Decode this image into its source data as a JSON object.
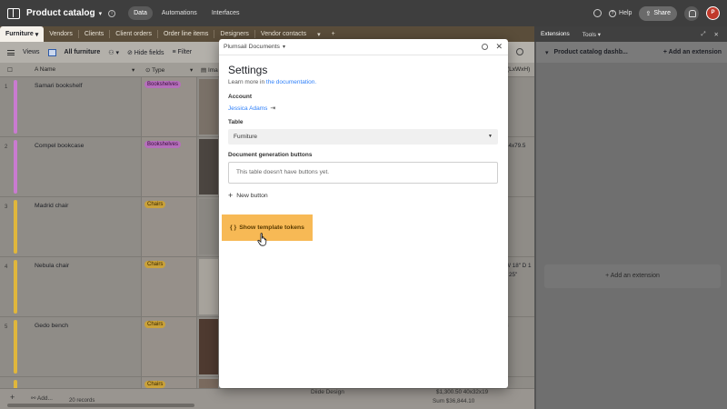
{
  "header": {
    "base_name": "Product catalog",
    "nav": [
      "Data",
      "Automations",
      "Interfaces"
    ],
    "help_label": "Help",
    "share_label": "Share",
    "avatar_initial": "P"
  },
  "tabs": [
    "Furniture",
    "Vendors",
    "Clients",
    "Client orders",
    "Order line items",
    "Designers",
    "Vendor contacts"
  ],
  "extensions_bar": {
    "tabs": [
      "Extensions",
      "Tools"
    ]
  },
  "toolbar": {
    "views_label": "Views",
    "view_name": "All furniture",
    "hide_fields_label": "Hide fields",
    "filter_label": "Filter"
  },
  "columns": {
    "name": "Name",
    "type": "Type",
    "image": "Ima",
    "size": "(LxWxH)"
  },
  "rows": [
    {
      "num": "1",
      "name": "Samari bookshelf",
      "type": "Bookshelves",
      "color": "#c97bd0",
      "extra": ""
    },
    {
      "num": "2",
      "name": "Compel bookcase",
      "type": "Bookshelves",
      "color": "#c97bd0",
      "extra": "14x79.5"
    },
    {
      "num": "3",
      "name": "Madrid chair",
      "type": "Chairs",
      "color": "#e0b63c",
      "extra": ""
    },
    {
      "num": "4",
      "name": "Nebula chair",
      "type": "Chairs",
      "color": "#e0b63c",
      "extra": "W 18\" D 1"
    },
    {
      "num": "5",
      "name": "Gedo bench",
      "type": "Chairs",
      "color": "#e0b63c",
      "extra": "8"
    },
    {
      "num": "6",
      "name": "",
      "type": "Chairs",
      "color": "#e0b63c",
      "extra": ""
    }
  ],
  "row4_extra2": "25\"",
  "footer": {
    "add_label": "Add...",
    "records": "20 records",
    "last_name": "Diide Design",
    "last_price": "$1,300.50",
    "last_code": "40x32x19",
    "sum": "Sum $36,844.10"
  },
  "ext_panel": {
    "dashboard_name": "Product catalog dashb...",
    "add_extension_header": "Add an extension",
    "add_extension_box": "Add an extension"
  },
  "modal": {
    "app_name": "Plumsail Documents",
    "title": "Settings",
    "learn_prefix": "Learn more in",
    "learn_link": "the documentation.",
    "account_label": "Account",
    "account_name": "Jessica Adams",
    "table_label": "Table",
    "table_value": "Furniture",
    "docgen_label": "Document generation buttons",
    "docgen_placeholder": "This table doesn't have buttons yet.",
    "new_button_label": "New button",
    "tokens_button_label": "Show template tokens"
  }
}
